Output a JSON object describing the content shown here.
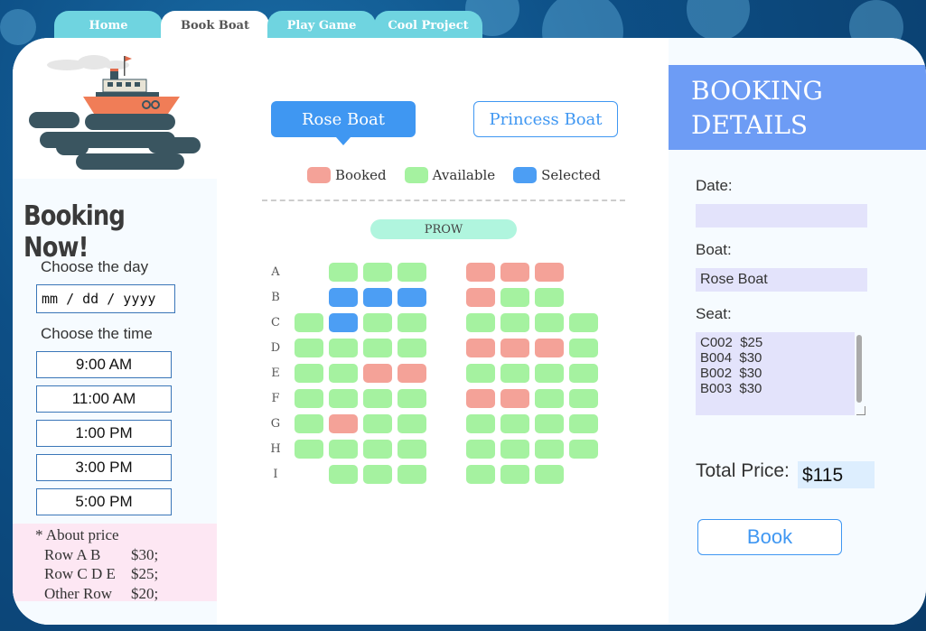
{
  "tabs": [
    {
      "label": "Home",
      "active": false
    },
    {
      "label": "Book Boat",
      "active": true
    },
    {
      "label": "Play Game",
      "active": false
    },
    {
      "label": "Cool Project",
      "active": false
    }
  ],
  "left": {
    "title": "Booking Now!",
    "choose_day_label": "Choose the day",
    "date_placeholder": "mm / dd / yyyy",
    "choose_time_label": "Choose the time",
    "times": [
      "9:00 AM",
      "11:00 AM",
      "1:00 PM",
      "3:00 PM",
      "5:00 PM"
    ],
    "price_note": {
      "heading": "* About price",
      "rows": [
        {
          "rows": "Row A B",
          "price": "$30;"
        },
        {
          "rows": "Row C D E",
          "price": "$25;"
        },
        {
          "rows": "Other Row",
          "price": "$20;"
        }
      ]
    }
  },
  "boats": {
    "rose": "Rose Boat",
    "princess": "Princess Boat",
    "selected": "rose"
  },
  "legend": {
    "booked": "Booked",
    "available": "Available",
    "selected": "Selected"
  },
  "colors": {
    "booked": "#f4a298",
    "available": "#a5f2a0",
    "selected": "#4c9ef4",
    "accent": "#3f97f2"
  },
  "prow_label": "PROW",
  "seat_rows": [
    {
      "label": "A",
      "seats": [
        "",
        "available",
        "available",
        "available",
        "",
        "booked",
        "booked",
        "booked",
        ""
      ]
    },
    {
      "label": "B",
      "seats": [
        "",
        "selected",
        "selected",
        "selected",
        "",
        "booked",
        "available",
        "available",
        ""
      ]
    },
    {
      "label": "C",
      "seats": [
        "available",
        "selected",
        "available",
        "available",
        "",
        "available",
        "available",
        "available",
        "available"
      ]
    },
    {
      "label": "D",
      "seats": [
        "available",
        "available",
        "available",
        "available",
        "",
        "booked",
        "booked",
        "booked",
        "available"
      ]
    },
    {
      "label": "E",
      "seats": [
        "available",
        "available",
        "booked",
        "booked",
        "",
        "available",
        "available",
        "available",
        "available"
      ]
    },
    {
      "label": "F",
      "seats": [
        "available",
        "available",
        "available",
        "available",
        "",
        "booked",
        "booked",
        "available",
        "available"
      ]
    },
    {
      "label": "G",
      "seats": [
        "available",
        "booked",
        "available",
        "available",
        "",
        "available",
        "available",
        "available",
        "available"
      ]
    },
    {
      "label": "H",
      "seats": [
        "available",
        "available",
        "available",
        "available",
        "",
        "available",
        "available",
        "available",
        "available"
      ]
    },
    {
      "label": "I",
      "seats": [
        "",
        "available",
        "available",
        "available",
        "",
        "available",
        "available",
        "available",
        ""
      ]
    }
  ],
  "details": {
    "title_line1": "BOOKING",
    "title_line2": "DETAILS",
    "date_label": "Date:",
    "date_value": "",
    "boat_label": "Boat:",
    "boat_value": "Rose Boat",
    "seat_label": "Seat:",
    "seats": [
      "C002  $25",
      "B004  $30",
      "B002  $30",
      "B003  $30"
    ],
    "total_label": "Total Price:",
    "total_value": "$115",
    "book_label": "Book"
  }
}
